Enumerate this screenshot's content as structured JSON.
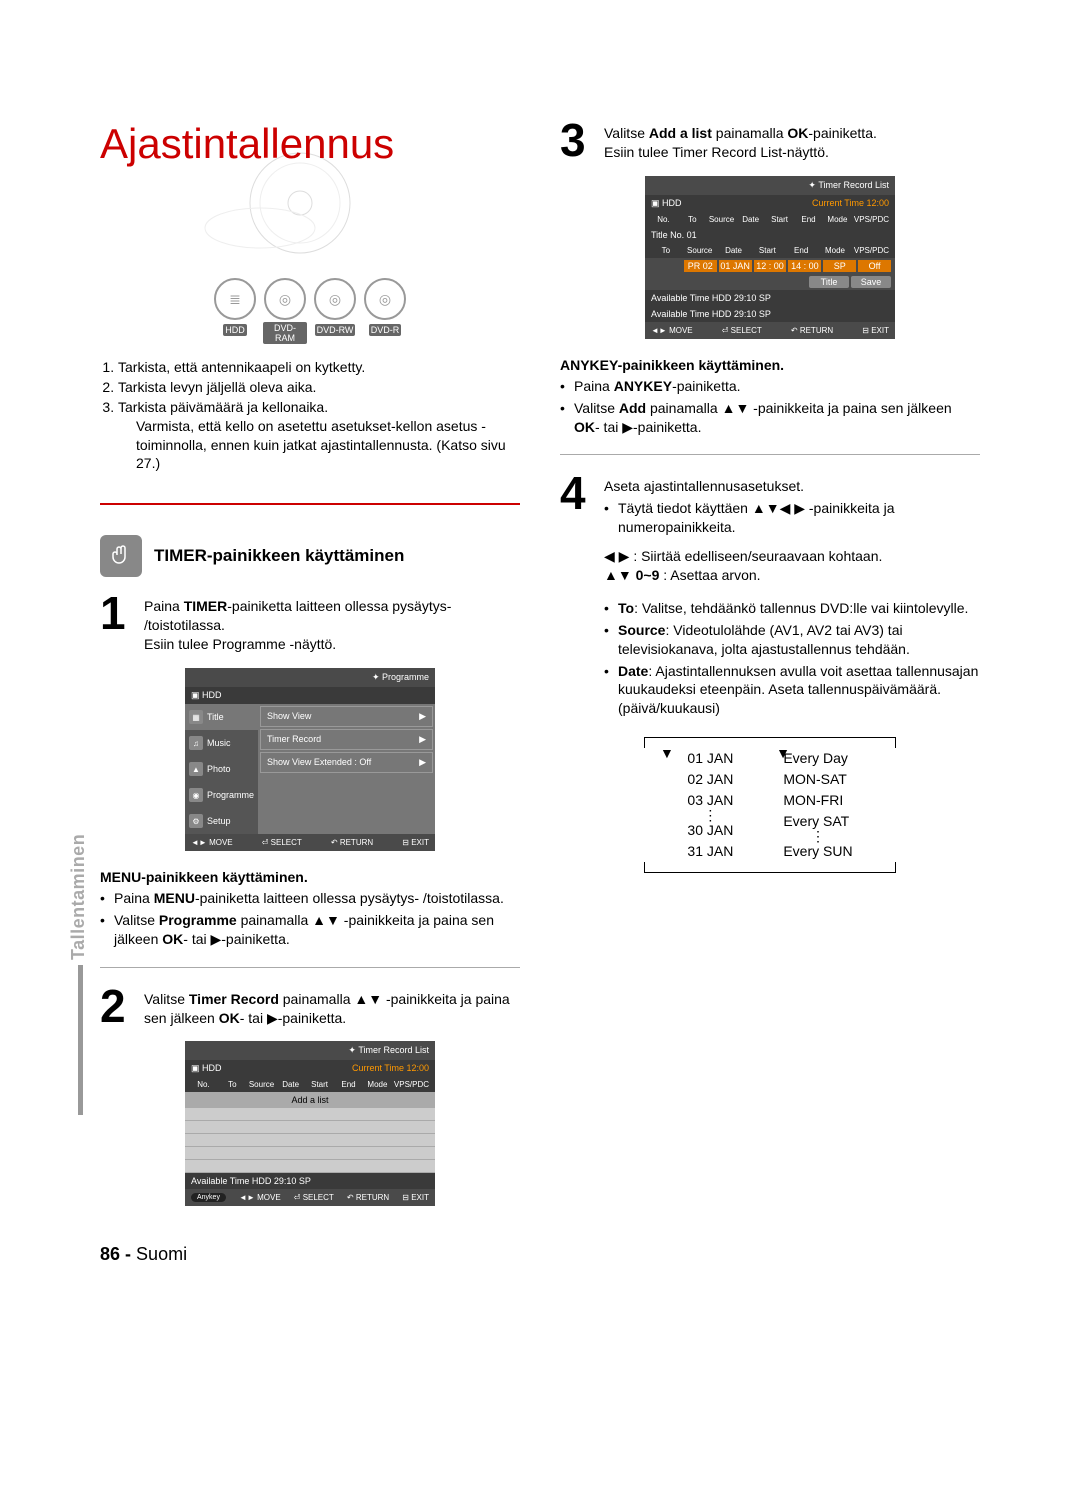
{
  "title": "Ajastintallennus",
  "media_icons": [
    {
      "label": "HDD",
      "glyph": "≣"
    },
    {
      "label": "DVD-RAM",
      "glyph": "◎"
    },
    {
      "label": "DVD-RW",
      "glyph": "◎"
    },
    {
      "label": "DVD-R",
      "glyph": "◎"
    }
  ],
  "prechecks": [
    "Tarkista, että antennikaapeli on kytketty.",
    "Tarkista levyn jäljellä oleva aika.",
    "Tarkista päivämäärä ja kellonaika."
  ],
  "precheck_extra": "Varmista, että kello on asetettu asetukset-kellon asetus -toiminnolla, ennen kuin jatkat ajastintallennusta. (Katso sivu 27.)",
  "section_heading": "TIMER-painikkeen käyttäminen",
  "step1": {
    "text_before": "Paina ",
    "bold1": "TIMER",
    "text_mid": "-painiketta laitteen ollessa pysäytys- /toistotilassa.",
    "text_after": "Esiin tulee Programme -näyttö."
  },
  "ui_programme": {
    "header": "Programme",
    "device": "HDD",
    "side": [
      "Title",
      "Music",
      "Photo",
      "Programme",
      "Setup"
    ],
    "main": [
      "Show View",
      "Timer Record",
      "Show View Extended : Off"
    ],
    "foot": [
      "MOVE",
      "SELECT",
      "RETURN",
      "EXIT"
    ]
  },
  "menu_subhead": "MENU-painikkeen käyttäminen.",
  "menu_bullets": [
    {
      "pre": "Paina ",
      "b": "MENU",
      "post": "-painiketta laitteen ollessa pysäytys- /toistotilassa."
    },
    {
      "pre": "Valitse ",
      "b": "Programme",
      "post2": " painamalla ▲▼ -painikkeita ja paina sen jälkeen ",
      "b2": "OK",
      "post3": "- tai ▶-painiketta."
    }
  ],
  "step2": {
    "pre": "Valitse ",
    "b": "Timer Record",
    "mid": " painamalla ▲▼ -painikkeita ja paina sen jälkeen ",
    "b2": "OK",
    "post": "- tai ▶-painiketta."
  },
  "ui_trl": {
    "header": "Timer Record List",
    "device": "HDD",
    "current": "Current Time 12:00",
    "cols": [
      "No.",
      "To",
      "Source",
      "Date",
      "Start",
      "End",
      "Mode",
      "VPS/PDC"
    ],
    "add": "Add a list",
    "avail": "Available Time    HDD    29:10  SP",
    "anykey": "Anykey",
    "foot": [
      "MOVE",
      "SELECT",
      "RETURN",
      "EXIT"
    ]
  },
  "step3": {
    "pre": "Valitse ",
    "b": "Add a list",
    "mid": " painamalla ",
    "b2": "OK",
    "post": "-painiketta.",
    "after": "Esiin tulee Timer Record List-näyttö."
  },
  "ui_trl2": {
    "header": "Timer Record List",
    "device": "HDD",
    "current": "Current Time 12:00",
    "cols": [
      "No.",
      "To",
      "Source",
      "Date",
      "Start",
      "End",
      "Mode",
      "VPS/PDC"
    ],
    "titleno": "Title No. 01",
    "rowcols": [
      "To",
      "Source",
      "Date",
      "Start",
      "End",
      "Mode",
      "VPS/PDC"
    ],
    "row": [
      "",
      "PR 02",
      "01 JAN",
      "12 : 00",
      "14 : 00",
      "SP",
      "Off"
    ],
    "btns": [
      "Title",
      "Save"
    ],
    "avail1": "Available Time    HDD    29:10  SP",
    "avail2": "Available Time    HDD    29:10  SP",
    "foot": [
      "MOVE",
      "SELECT",
      "RETURN",
      "EXIT"
    ]
  },
  "anykey_subhead": "ANYKEY-painikkeen käyttäminen.",
  "anykey_bullets": [
    {
      "pre": "Paina ",
      "b": "ANYKEY",
      "post": "-painiketta."
    },
    {
      "pre": "Valitse ",
      "b": "Add",
      "mid": " painamalla ▲▼ -painikkeita ja paina sen jälkeen ",
      "b2": "OK",
      "post": "- tai ▶-painiketta."
    }
  ],
  "step4": {
    "line1": "Aseta ajastintallennusasetukset.",
    "sub1": "Täytä tiedot käyttäen ▲▼◀ ▶ -painikkeita ja numeropainikkeita.",
    "sub2": "◀ ▶ : Siirtää edelliseen/seuraavaan kohtaan.",
    "sub3_pre": "▲▼ ",
    "sub3_b": "0~9",
    "sub3_post": " : Asettaa arvon.",
    "bullets": [
      {
        "b": "To",
        "post": ": Valitse, tehdäänkö tallennus DVD:lle vai kiintolevylle."
      },
      {
        "b": "Source",
        "post": ": Videotulolähde (AV1, AV2 tai AV3) tai televisiokanava, jolta ajastustallennus tehdään."
      },
      {
        "b": "Date",
        "post": ": Ajastintallennuksen avulla voit asettaa tallennusajan kuukaudeksi eteenpäin. Aseta tallennuspäivämäärä. (päivä/kuukausi)"
      }
    ]
  },
  "date_fig": {
    "left": [
      "01 JAN",
      "02 JAN",
      "03 JAN",
      "⋮",
      "30 JAN",
      "31 JAN"
    ],
    "right": [
      "Every Day",
      "MON-SAT",
      "MON-FRI",
      "Every SAT",
      "⋮",
      "Every SUN"
    ]
  },
  "side_tab": "Tallentaminen",
  "footer": {
    "page": "86 -",
    "lang": "Suomi"
  }
}
